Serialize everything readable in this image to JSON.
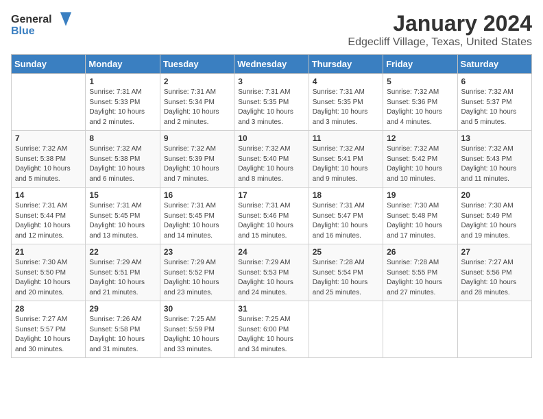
{
  "header": {
    "logo_general": "General",
    "logo_blue": "Blue",
    "title": "January 2024",
    "location": "Edgecliff Village, Texas, United States"
  },
  "days_of_week": [
    "Sunday",
    "Monday",
    "Tuesday",
    "Wednesday",
    "Thursday",
    "Friday",
    "Saturday"
  ],
  "weeks": [
    [
      {
        "day": "",
        "info": ""
      },
      {
        "day": "1",
        "info": "Sunrise: 7:31 AM\nSunset: 5:33 PM\nDaylight: 10 hours\nand 2 minutes."
      },
      {
        "day": "2",
        "info": "Sunrise: 7:31 AM\nSunset: 5:34 PM\nDaylight: 10 hours\nand 2 minutes."
      },
      {
        "day": "3",
        "info": "Sunrise: 7:31 AM\nSunset: 5:35 PM\nDaylight: 10 hours\nand 3 minutes."
      },
      {
        "day": "4",
        "info": "Sunrise: 7:31 AM\nSunset: 5:35 PM\nDaylight: 10 hours\nand 3 minutes."
      },
      {
        "day": "5",
        "info": "Sunrise: 7:32 AM\nSunset: 5:36 PM\nDaylight: 10 hours\nand 4 minutes."
      },
      {
        "day": "6",
        "info": "Sunrise: 7:32 AM\nSunset: 5:37 PM\nDaylight: 10 hours\nand 5 minutes."
      }
    ],
    [
      {
        "day": "7",
        "info": "Sunrise: 7:32 AM\nSunset: 5:38 PM\nDaylight: 10 hours\nand 5 minutes."
      },
      {
        "day": "8",
        "info": "Sunrise: 7:32 AM\nSunset: 5:38 PM\nDaylight: 10 hours\nand 6 minutes."
      },
      {
        "day": "9",
        "info": "Sunrise: 7:32 AM\nSunset: 5:39 PM\nDaylight: 10 hours\nand 7 minutes."
      },
      {
        "day": "10",
        "info": "Sunrise: 7:32 AM\nSunset: 5:40 PM\nDaylight: 10 hours\nand 8 minutes."
      },
      {
        "day": "11",
        "info": "Sunrise: 7:32 AM\nSunset: 5:41 PM\nDaylight: 10 hours\nand 9 minutes."
      },
      {
        "day": "12",
        "info": "Sunrise: 7:32 AM\nSunset: 5:42 PM\nDaylight: 10 hours\nand 10 minutes."
      },
      {
        "day": "13",
        "info": "Sunrise: 7:32 AM\nSunset: 5:43 PM\nDaylight: 10 hours\nand 11 minutes."
      }
    ],
    [
      {
        "day": "14",
        "info": "Sunrise: 7:31 AM\nSunset: 5:44 PM\nDaylight: 10 hours\nand 12 minutes."
      },
      {
        "day": "15",
        "info": "Sunrise: 7:31 AM\nSunset: 5:45 PM\nDaylight: 10 hours\nand 13 minutes."
      },
      {
        "day": "16",
        "info": "Sunrise: 7:31 AM\nSunset: 5:45 PM\nDaylight: 10 hours\nand 14 minutes."
      },
      {
        "day": "17",
        "info": "Sunrise: 7:31 AM\nSunset: 5:46 PM\nDaylight: 10 hours\nand 15 minutes."
      },
      {
        "day": "18",
        "info": "Sunrise: 7:31 AM\nSunset: 5:47 PM\nDaylight: 10 hours\nand 16 minutes."
      },
      {
        "day": "19",
        "info": "Sunrise: 7:30 AM\nSunset: 5:48 PM\nDaylight: 10 hours\nand 17 minutes."
      },
      {
        "day": "20",
        "info": "Sunrise: 7:30 AM\nSunset: 5:49 PM\nDaylight: 10 hours\nand 19 minutes."
      }
    ],
    [
      {
        "day": "21",
        "info": "Sunrise: 7:30 AM\nSunset: 5:50 PM\nDaylight: 10 hours\nand 20 minutes."
      },
      {
        "day": "22",
        "info": "Sunrise: 7:29 AM\nSunset: 5:51 PM\nDaylight: 10 hours\nand 21 minutes."
      },
      {
        "day": "23",
        "info": "Sunrise: 7:29 AM\nSunset: 5:52 PM\nDaylight: 10 hours\nand 23 minutes."
      },
      {
        "day": "24",
        "info": "Sunrise: 7:29 AM\nSunset: 5:53 PM\nDaylight: 10 hours\nand 24 minutes."
      },
      {
        "day": "25",
        "info": "Sunrise: 7:28 AM\nSunset: 5:54 PM\nDaylight: 10 hours\nand 25 minutes."
      },
      {
        "day": "26",
        "info": "Sunrise: 7:28 AM\nSunset: 5:55 PM\nDaylight: 10 hours\nand 27 minutes."
      },
      {
        "day": "27",
        "info": "Sunrise: 7:27 AM\nSunset: 5:56 PM\nDaylight: 10 hours\nand 28 minutes."
      }
    ],
    [
      {
        "day": "28",
        "info": "Sunrise: 7:27 AM\nSunset: 5:57 PM\nDaylight: 10 hours\nand 30 minutes."
      },
      {
        "day": "29",
        "info": "Sunrise: 7:26 AM\nSunset: 5:58 PM\nDaylight: 10 hours\nand 31 minutes."
      },
      {
        "day": "30",
        "info": "Sunrise: 7:25 AM\nSunset: 5:59 PM\nDaylight: 10 hours\nand 33 minutes."
      },
      {
        "day": "31",
        "info": "Sunrise: 7:25 AM\nSunset: 6:00 PM\nDaylight: 10 hours\nand 34 minutes."
      },
      {
        "day": "",
        "info": ""
      },
      {
        "day": "",
        "info": ""
      },
      {
        "day": "",
        "info": ""
      }
    ]
  ]
}
